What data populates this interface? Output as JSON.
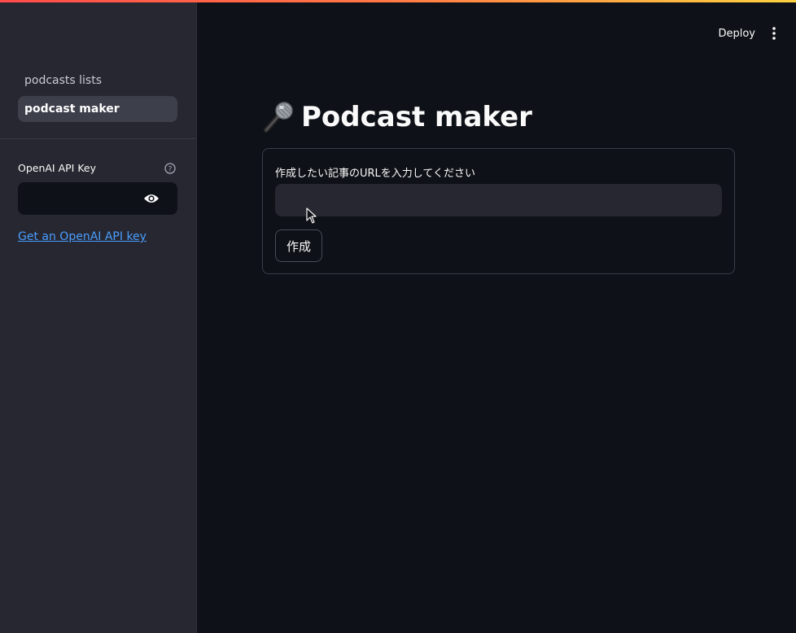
{
  "sidebar": {
    "nav_items": [
      {
        "label": "podcasts lists",
        "active": false
      },
      {
        "label": "podcast maker",
        "active": true
      }
    ],
    "api_key": {
      "label": "OpenAI API Key",
      "value": "",
      "help_icon": "question-circle-icon",
      "toggle_icon": "eye-icon"
    },
    "api_link": "Get an OpenAI API key"
  },
  "header": {
    "deploy_label": "Deploy",
    "menu_icon": "kebab-menu-icon"
  },
  "main": {
    "title": "Podcast maker",
    "title_icon": "microphone-icon",
    "form": {
      "label": "作成したい記事のURLを入力してください",
      "url_value": "",
      "submit_label": "作成"
    }
  },
  "colors": {
    "background": "#0e1117",
    "sidebar": "#262730",
    "link": "#4a9dff",
    "nav_active": "#3d3f4b"
  }
}
